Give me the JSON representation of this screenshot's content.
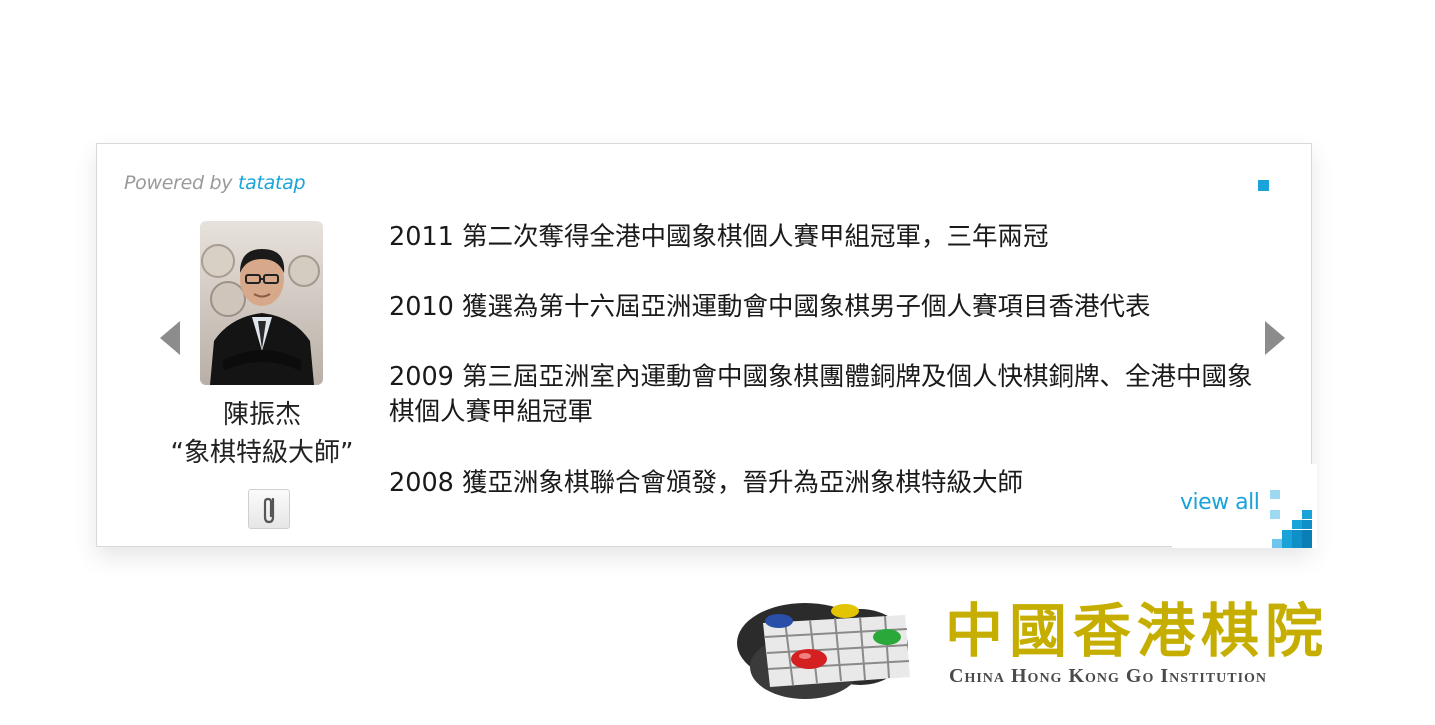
{
  "widget": {
    "powered_by_prefix": "Powered by ",
    "powered_by_brand": "tatatap",
    "view_all_label": "view all",
    "accent_color": "#1aa3d9"
  },
  "profile": {
    "name": "陳振杰",
    "title": "“象棋特級大師”",
    "photo_icon": "person-photo",
    "attachment_icon": "paperclip-icon"
  },
  "events": [
    {
      "text": "2011 第二次奪得全港中國象棋個人賽甲組冠軍，三年兩冠"
    },
    {
      "text": "2010 獲選為第十六屆亞洲運動會中國象棋男子個人賽項目香港代表"
    },
    {
      "text": "2009 第三屆亞洲室內運動會中國象棋團體銅牌及個人快棋銅牌、全港中國象棋個人賽甲組冠軍"
    },
    {
      "text": "2008 獲亞洲象棋聯合會頒發，晉升為亞洲象棋特級大師"
    }
  ],
  "logo": {
    "chinese": "中國香港棋院",
    "english": "China Hong Kong Go Institution",
    "color": "#c6ae00"
  }
}
